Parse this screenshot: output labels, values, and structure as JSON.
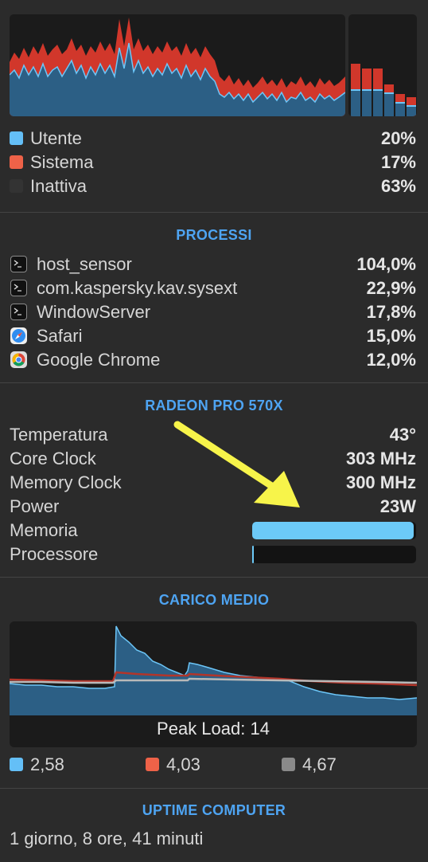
{
  "cpu": {
    "legend": [
      {
        "name": "Utente",
        "value": "20%",
        "color": "#64bff7"
      },
      {
        "name": "Sistema",
        "value": "17%",
        "color": "#ee6248"
      },
      {
        "name": "Inattiva",
        "value": "63%",
        "color": "#333333"
      }
    ]
  },
  "processes": {
    "title": "PROCESSI",
    "items": [
      {
        "name": "host_sensor",
        "value": "104,0%",
        "icon": "terminal-icon"
      },
      {
        "name": "com.kaspersky.kav.sysext",
        "value": "22,9%",
        "icon": "terminal-icon"
      },
      {
        "name": "WindowServer",
        "value": "17,8%",
        "icon": "terminal-icon"
      },
      {
        "name": "Safari",
        "value": "15,0%",
        "icon": "safari-icon"
      },
      {
        "name": "Google Chrome",
        "value": "12,0%",
        "icon": "chrome-icon"
      }
    ]
  },
  "gpu": {
    "title": "RADEON PRO 570X",
    "temperature": {
      "label": "Temperatura",
      "value": "43°"
    },
    "core_clock": {
      "label": "Core Clock",
      "value": "303 MHz"
    },
    "memory_clock": {
      "label": "Memory Clock",
      "value": "300 MHz"
    },
    "power": {
      "label": "Power",
      "value": "23W"
    },
    "memory": {
      "label": "Memoria",
      "fraction": 0.985
    },
    "processor": {
      "label": "Processore",
      "fraction": 0.01
    },
    "bar_color": "#6ccaf8",
    "arrow_color": "#f7f44a"
  },
  "load": {
    "title": "CARICO MEDIO",
    "peak": "Peak Load: 14",
    "legend": [
      {
        "value": "2,58",
        "color": "#64bff7"
      },
      {
        "value": "4,03",
        "color": "#ee6248"
      },
      {
        "value": "4,67",
        "color": "#8a8a8a"
      }
    ]
  },
  "uptime": {
    "title": "UPTIME COMPUTER",
    "value": "1 giorno, 8 ore, 41 minuti"
  }
}
